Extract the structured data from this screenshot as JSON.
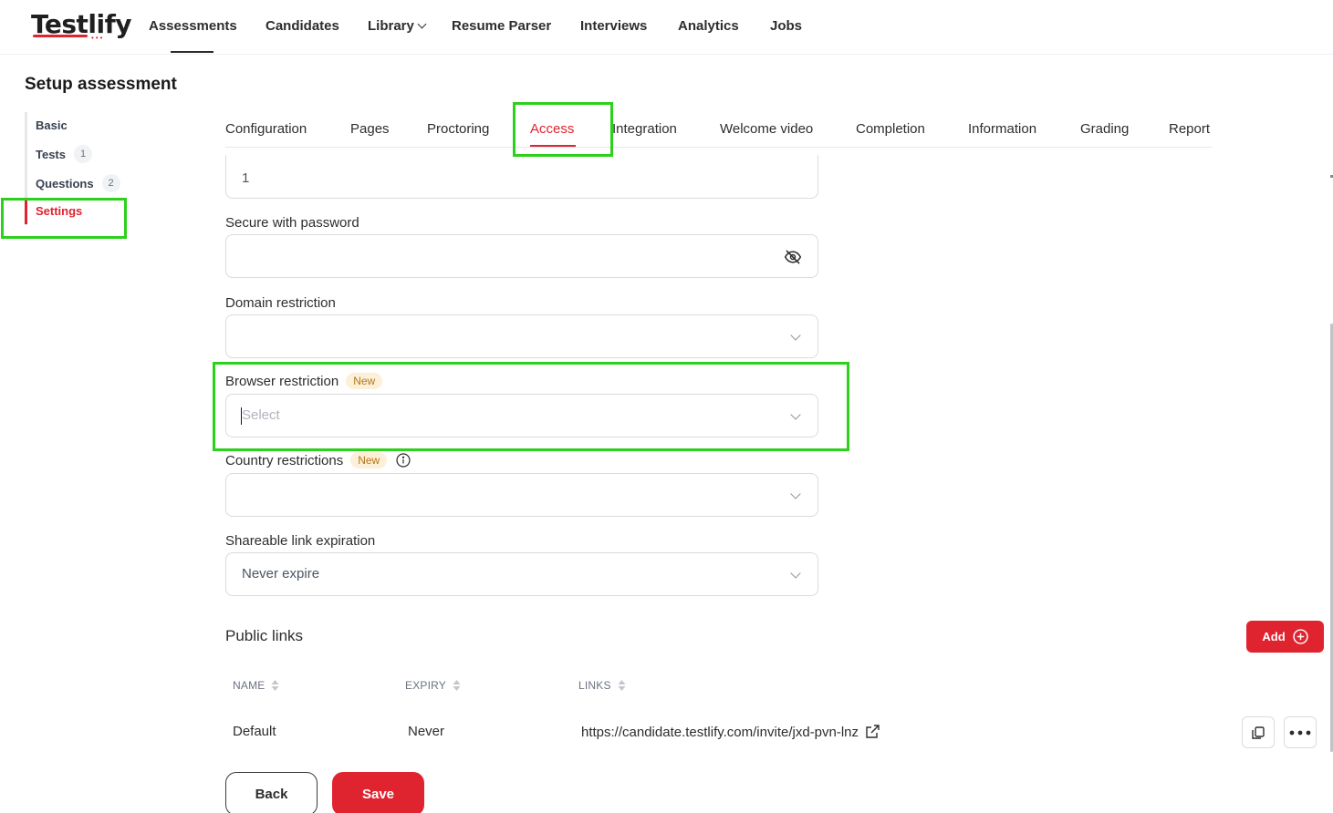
{
  "app": {
    "logo_text": "Testlify",
    "logo_dots": "•••"
  },
  "nav": {
    "items": [
      "Assessments",
      "Candidates",
      "Library",
      "Resume Parser",
      "Interviews",
      "Analytics",
      "Jobs"
    ],
    "active": "Assessments"
  },
  "page": {
    "title": "Setup assessment"
  },
  "side_menu": {
    "items": [
      {
        "label": "Basic",
        "count": null
      },
      {
        "label": "Tests",
        "count": "1"
      },
      {
        "label": "Questions",
        "count": "2"
      },
      {
        "label": "Settings",
        "count": null
      }
    ],
    "active": "Settings"
  },
  "tabs": {
    "items": [
      "Configuration",
      "Pages",
      "Proctoring",
      "Access",
      "Integration",
      "Welcome video",
      "Completion",
      "Information",
      "Grading",
      "Report"
    ],
    "active": "Access"
  },
  "form": {
    "top_field_value": "1",
    "password": {
      "label": "Secure with password",
      "value": ""
    },
    "domain": {
      "label": "Domain restriction",
      "value": ""
    },
    "browser": {
      "label": "Browser restriction",
      "badge": "New",
      "placeholder": "Select"
    },
    "country": {
      "label": "Country restrictions",
      "badge": "New",
      "value": ""
    },
    "expiration": {
      "label": "Shareable link expiration",
      "value": "Never expire"
    }
  },
  "public_links": {
    "title": "Public links",
    "add_label": "Add",
    "columns": [
      "NAME",
      "EXPIRY",
      "LINKS"
    ],
    "rows": [
      {
        "name": "Default",
        "expiry": "Never",
        "link": "https://candidate.testlify.com/invite/jxd-pvn-lnz"
      }
    ]
  },
  "actions": {
    "back_label": "Back",
    "save_label": "Save"
  },
  "colors": {
    "accent": "#e0242f",
    "highlight": "#2bd11a",
    "badge_bg": "#fdf0d8",
    "badge_text": "#b4761c"
  }
}
